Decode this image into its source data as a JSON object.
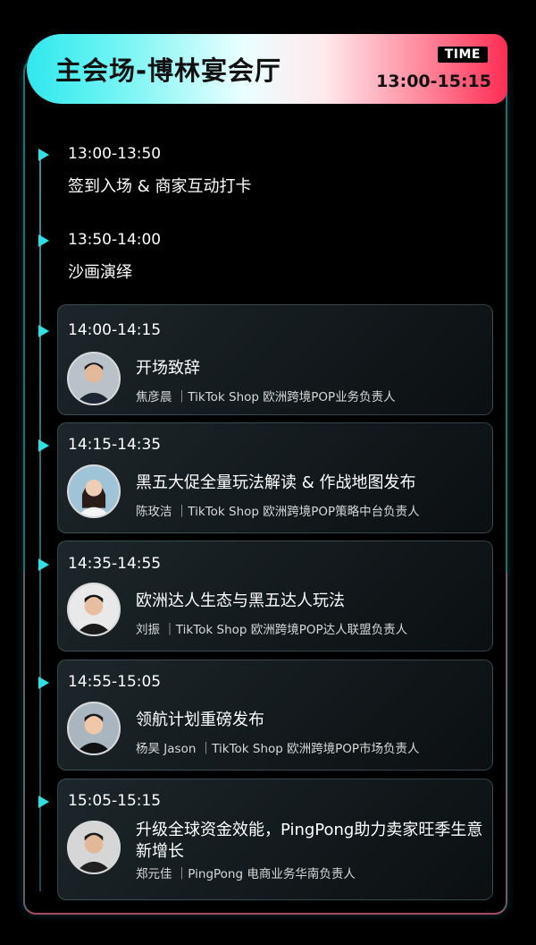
{
  "header": {
    "title": "主会场-博林宴会厅",
    "badge": "TIME",
    "time": "13:00-15:15"
  },
  "agenda": [
    {
      "time": "13:00-13:50",
      "title": "签到入场 & 商家互动打卡"
    },
    {
      "time": "13:50-14:00",
      "title": "沙画演绎"
    },
    {
      "time": "14:00-14:15",
      "title": "开场致辞",
      "speaker": "焦彦晨 ｜TikTok Shop 欧洲跨境POP业务负责人"
    },
    {
      "time": "14:15-14:35",
      "title": "黑五大促全量玩法解读 & 作战地图发布",
      "speaker": "陈玫洁 ｜TikTok Shop 欧洲跨境POP策略中台负责人"
    },
    {
      "time": "14:35-14:55",
      "title": "欧洲达人生态与黑五达人玩法",
      "speaker": "刘振 ｜TikTok Shop 欧洲跨境POP达人联盟负责人"
    },
    {
      "time": "14:55-15:05",
      "title": "领航计划重磅发布",
      "speaker": "杨昊 Jason ｜TikTok Shop 欧洲跨境POP市场负责人"
    },
    {
      "time": "15:05-15:15",
      "title": "升级全球资金效能，PingPong助力卖家旺季生意新增长",
      "speaker": "郑元佳 ｜PingPong 电商业务华南负责人"
    }
  ],
  "colors": {
    "accent_cyan": "#27e3e6",
    "accent_red": "#ff2d55",
    "background": "#000000"
  }
}
